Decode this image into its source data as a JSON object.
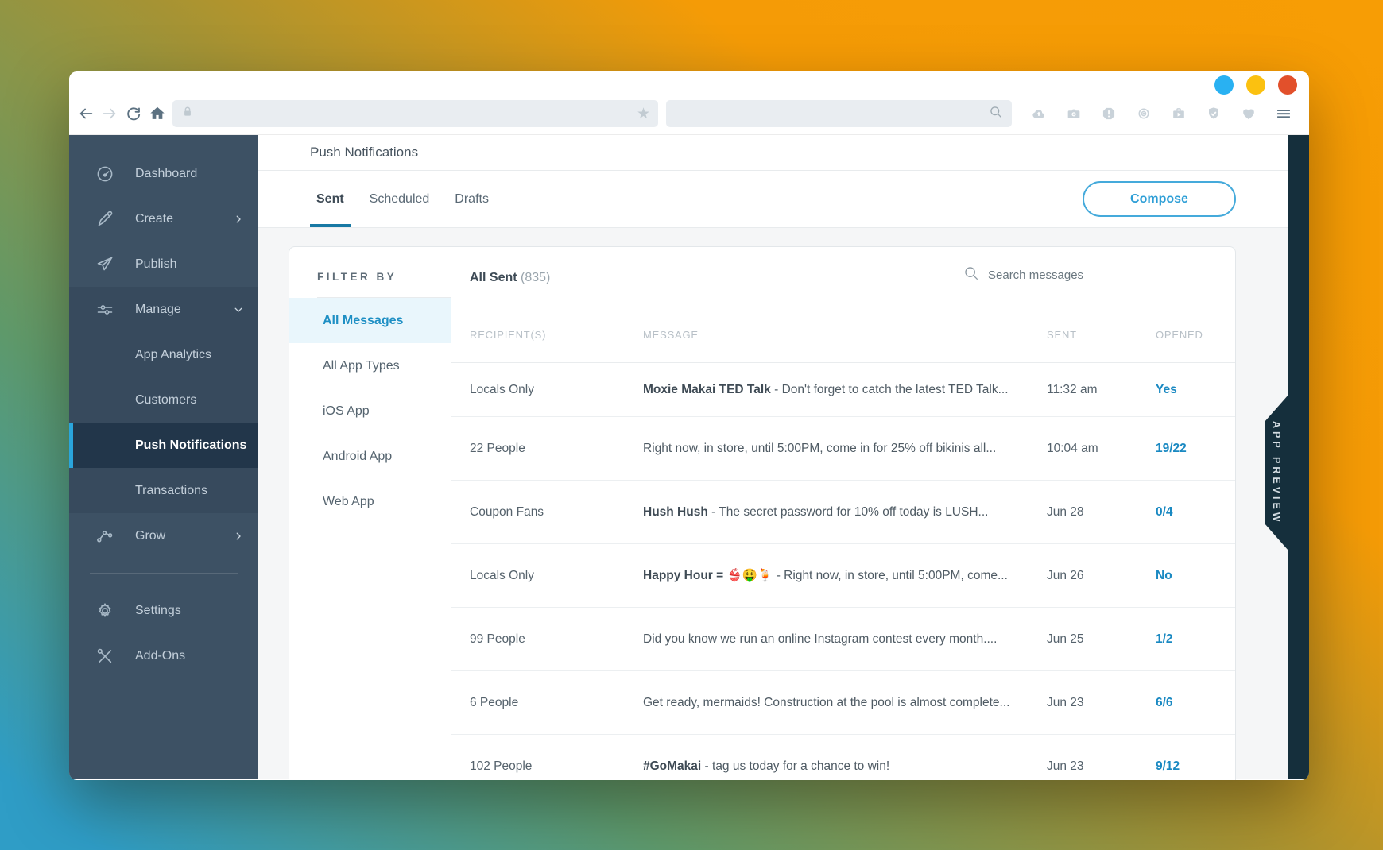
{
  "browser": {
    "traffic_lights": {
      "blue": "#29b1f2",
      "yellow": "#fbc110",
      "red": "#e2502b"
    },
    "nav_icons": [
      "back-icon",
      "forward-icon",
      "reload-icon",
      "home-icon"
    ],
    "address_bar": {
      "value": "",
      "icons": [
        "lock-icon",
        "star-icon"
      ]
    },
    "search_bar": {
      "value": "",
      "icon": "magnifier-icon"
    },
    "toolbar_icons": [
      "cloud-upload-icon",
      "camera-icon",
      "alert-octagon-icon",
      "broadcast-icon",
      "briefcase-play-icon",
      "shield-check-icon",
      "heart-icon",
      "menu-icon"
    ]
  },
  "sidebar": {
    "items": [
      {
        "label": "Dashboard",
        "icon": "gauge-icon"
      },
      {
        "label": "Create",
        "icon": "pencil-icon",
        "chevron": "right"
      },
      {
        "label": "Publish",
        "icon": "paper-plane-icon"
      },
      {
        "label": "Manage",
        "icon": "sliders-icon",
        "chevron": "down",
        "expanded": true
      },
      {
        "label": "App Analytics",
        "sub": true
      },
      {
        "label": "Customers",
        "sub": true
      },
      {
        "label": "Push Notifications",
        "sub": true,
        "active": true
      },
      {
        "label": "Transactions",
        "sub": true
      },
      {
        "label": "Grow",
        "icon": "nodes-icon",
        "chevron": "right"
      },
      {
        "label": "Settings",
        "icon": "gear-icon"
      },
      {
        "label": "Add-Ons",
        "icon": "tools-icon"
      }
    ]
  },
  "page": {
    "title": "Push Notifications",
    "tabs": [
      {
        "label": "Sent",
        "active": true
      },
      {
        "label": "Scheduled",
        "active": false
      },
      {
        "label": "Drafts",
        "active": false
      }
    ],
    "compose_label": "Compose"
  },
  "filter": {
    "heading": "FILTER BY",
    "items": [
      {
        "label": "All Messages",
        "active": true
      },
      {
        "label": "All App Types",
        "active": false
      },
      {
        "label": "iOS App",
        "active": false
      },
      {
        "label": "Android App",
        "active": false
      },
      {
        "label": "Web App",
        "active": false
      }
    ]
  },
  "table": {
    "title": "All Sent",
    "count": "(835)",
    "search_placeholder": "Search messages",
    "columns": [
      "RECIPIENT(S)",
      "MESSAGE",
      "SENT",
      "OPENED"
    ],
    "rows": [
      {
        "recipients": "Locals Only",
        "message_bold": "Moxie Makai TED Talk",
        "message_rest": " - Don't forget to catch the latest TED Talk...",
        "sent": "11:32 am",
        "opened": "Yes"
      },
      {
        "recipients": "22 People",
        "message_bold": "",
        "message_rest": "Right now, in store, until 5:00PM, come in for 25% off bikinis all...",
        "sent": "10:04 am",
        "opened": "19/22"
      },
      {
        "recipients": "Coupon Fans",
        "message_bold": "Hush Hush",
        "message_rest": " - The secret password for 10% off today is LUSH...",
        "sent": "Jun 28",
        "opened": "0/4"
      },
      {
        "recipients": "Locals Only",
        "message_bold": "Happy Hour = 👙🤑🍹",
        "message_rest": " - Right now, in store, until 5:00PM, come...",
        "sent": "Jun 26",
        "opened": "No"
      },
      {
        "recipients": "99 People",
        "message_bold": "",
        "message_rest": "Did you know we run an online Instagram contest every month....",
        "sent": "Jun 25",
        "opened": "1/2"
      },
      {
        "recipients": "6 People",
        "message_bold": "",
        "message_rest": "Get ready, mermaids! Construction at the pool is almost complete...",
        "sent": "Jun 23",
        "opened": "6/6"
      },
      {
        "recipients": "102 People",
        "message_bold": "#GoMakai",
        "message_rest": " - tag us today for a chance to win!",
        "sent": "Jun 23",
        "opened": "9/12"
      }
    ]
  },
  "app_preview_label": "APP PREVIEW",
  "colors": {
    "accent_blue": "#2aa3d8",
    "tab_underline": "#1879a4",
    "sidebar_bg": "#3d5164",
    "sidebar_section_bg": "#374a5d",
    "sidebar_active_bg": "#22364a",
    "rail_bg": "#152f3c",
    "active_filter_bg": "#e9f6fc",
    "opened_link": "#1a89c2"
  }
}
